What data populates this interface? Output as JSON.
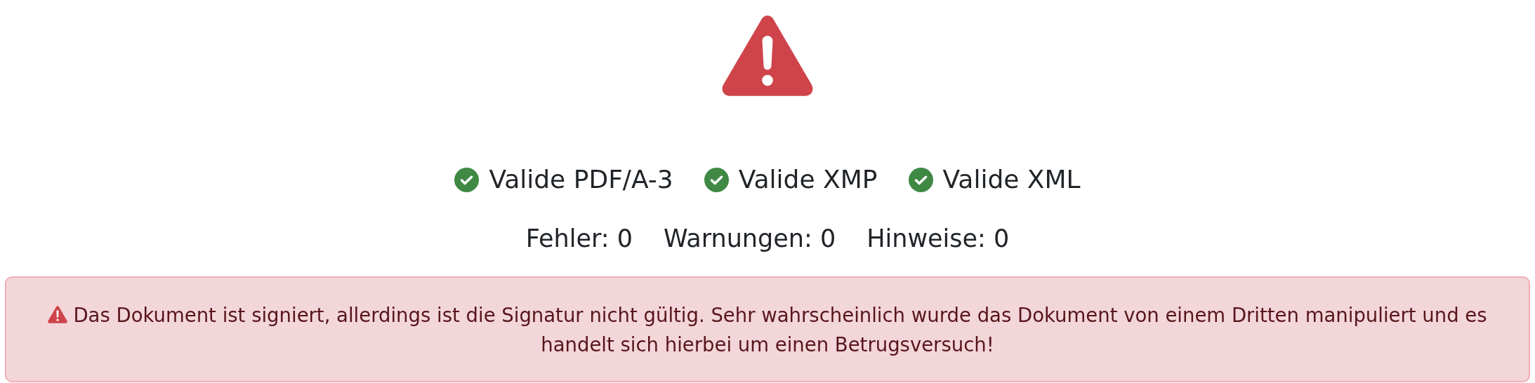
{
  "status": {
    "kind": "warning"
  },
  "checks": [
    {
      "label": "Valide PDF/A-3",
      "valid": true
    },
    {
      "label": "Valide XMP",
      "valid": true
    },
    {
      "label": "Valide XML",
      "valid": true
    }
  ],
  "counts": [
    "Fehler: 0",
    "Warnungen: 0",
    "Hinweise: 0"
  ],
  "alert": {
    "kind": "danger",
    "text": "Das Dokument ist signiert, allerdings ist die Signatur nicht gültig. Sehr wahrscheinlich wurde das Dokument von einem Dritten manipuliert und es handelt sich hierbei um einen Betrugsversuch!"
  }
}
